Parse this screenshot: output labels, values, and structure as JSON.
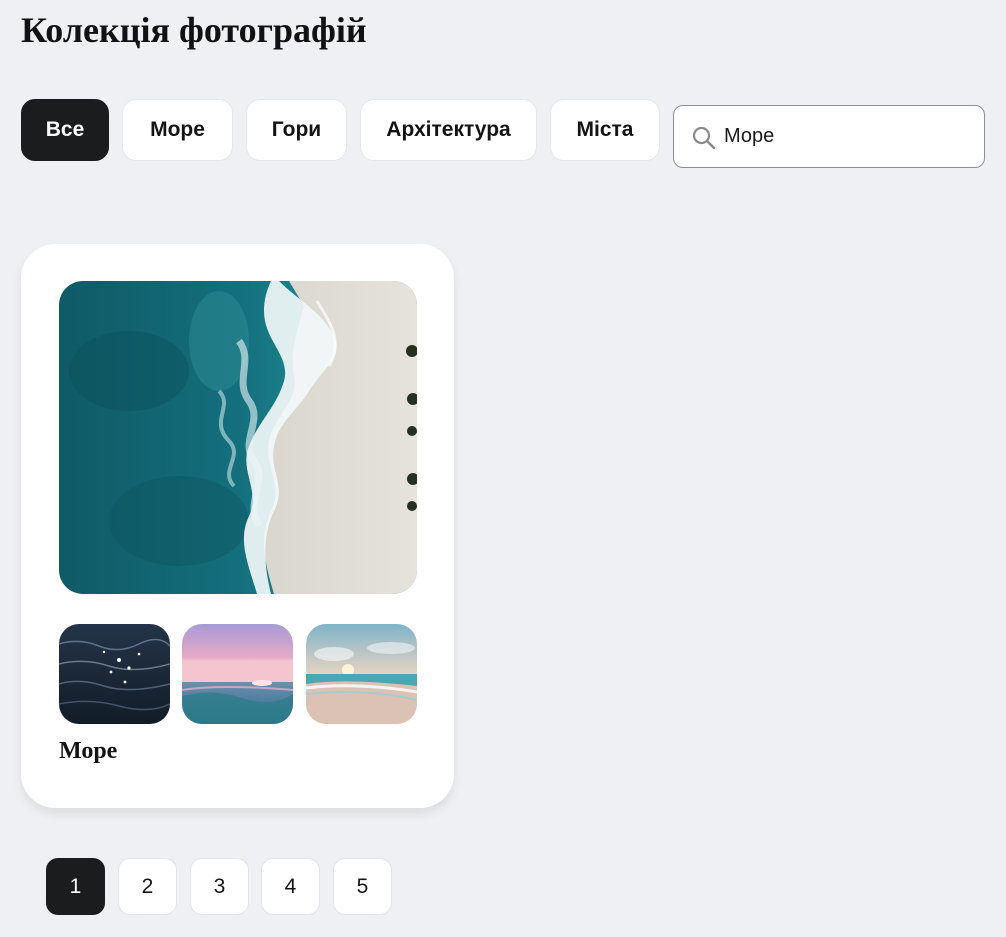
{
  "header": {
    "title": "Колекція фотографій"
  },
  "filters": [
    {
      "label": "Все",
      "active": true
    },
    {
      "label": "Море",
      "active": false
    },
    {
      "label": "Гори",
      "active": false
    },
    {
      "label": "Архітектура",
      "active": false
    },
    {
      "label": "Міста",
      "active": false
    }
  ],
  "search": {
    "value": "Море",
    "placeholder": ""
  },
  "gallery": {
    "cards": [
      {
        "title": "Море",
        "main_photo": "aerial-ocean-beach-image",
        "thumbnails": [
          "ocean-waves-image",
          "pink-sunset-sea-image",
          "beach-sunset-image"
        ]
      }
    ]
  },
  "pagination": {
    "pages": [
      "1",
      "2",
      "3",
      "4",
      "5"
    ],
    "current": "1"
  },
  "colors": {
    "background": "#eff0f3",
    "active_dark": "#1b1c1e",
    "surface": "#ffffff"
  }
}
